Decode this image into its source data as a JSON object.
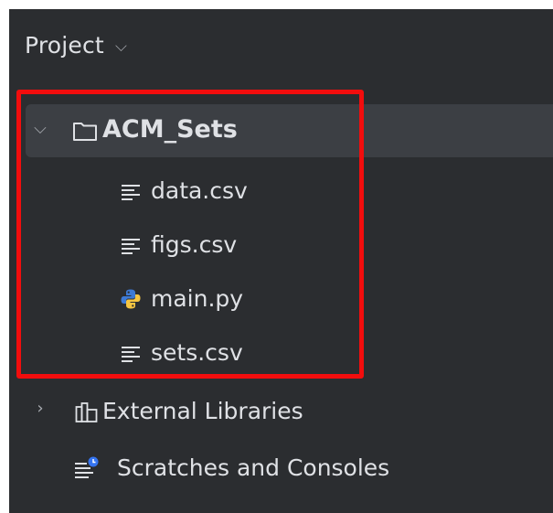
{
  "panel": {
    "title": "Project",
    "title_chevron_icon": "chevron-down-icon"
  },
  "tree": {
    "root": {
      "label": "ACM_Sets",
      "icon": "folder-icon",
      "expanded": true,
      "children": [
        {
          "label": "data.csv",
          "icon": "text-file-icon"
        },
        {
          "label": "figs.csv",
          "icon": "text-file-icon"
        },
        {
          "label": "main.py",
          "icon": "python-file-icon"
        },
        {
          "label": "sets.csv",
          "icon": "text-file-icon"
        }
      ]
    },
    "external_libraries": {
      "label": "External Libraries",
      "icon": "library-icon"
    },
    "scratches": {
      "label": "Scratches and Consoles",
      "icon": "scratches-icon"
    }
  },
  "colors": {
    "panel_background": "#2b2d30",
    "selection_background": "#3c3f44",
    "text": "#dfe1e5",
    "highlight_border": "#f20d0d",
    "python_blue": "#3d7ad6",
    "python_yellow": "#f5c542",
    "scratch_badge": "#3574f0"
  }
}
